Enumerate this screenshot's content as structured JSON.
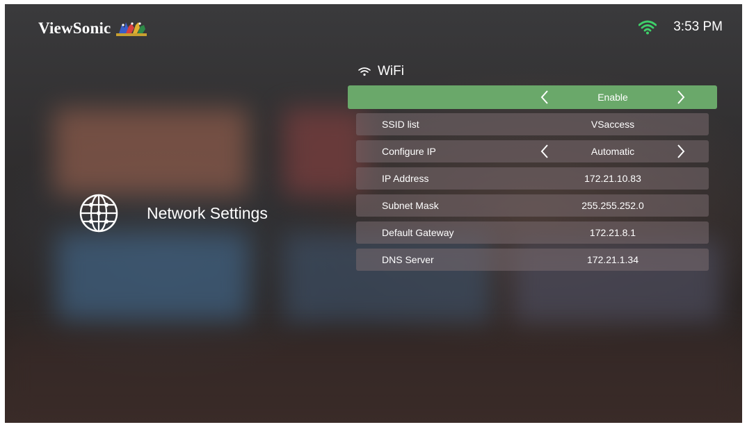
{
  "brand": {
    "name": "ViewSonic"
  },
  "status": {
    "time": "3:53 PM",
    "wifi_icon": "wifi-icon",
    "wifi_color": "#3fd06a"
  },
  "section": {
    "title": "Network Settings",
    "icon": "globe-icon"
  },
  "wifi": {
    "heading": "WiFi",
    "enable_value": "Enable",
    "highlight_color": "#6aa86a"
  },
  "settings": {
    "ssid": {
      "label": "SSID list",
      "value": "VSaccess"
    },
    "config": {
      "label": "Configure IP",
      "value": "Automatic"
    },
    "ip": {
      "label": "IP Address",
      "value": "172.21.10.83"
    },
    "subnet": {
      "label": "Subnet Mask",
      "value": "255.255.252.0"
    },
    "gateway": {
      "label": "Default Gateway",
      "value": "172.21.8.1"
    },
    "dns": {
      "label": "DNS Server",
      "value": "172.21.1.34"
    }
  }
}
